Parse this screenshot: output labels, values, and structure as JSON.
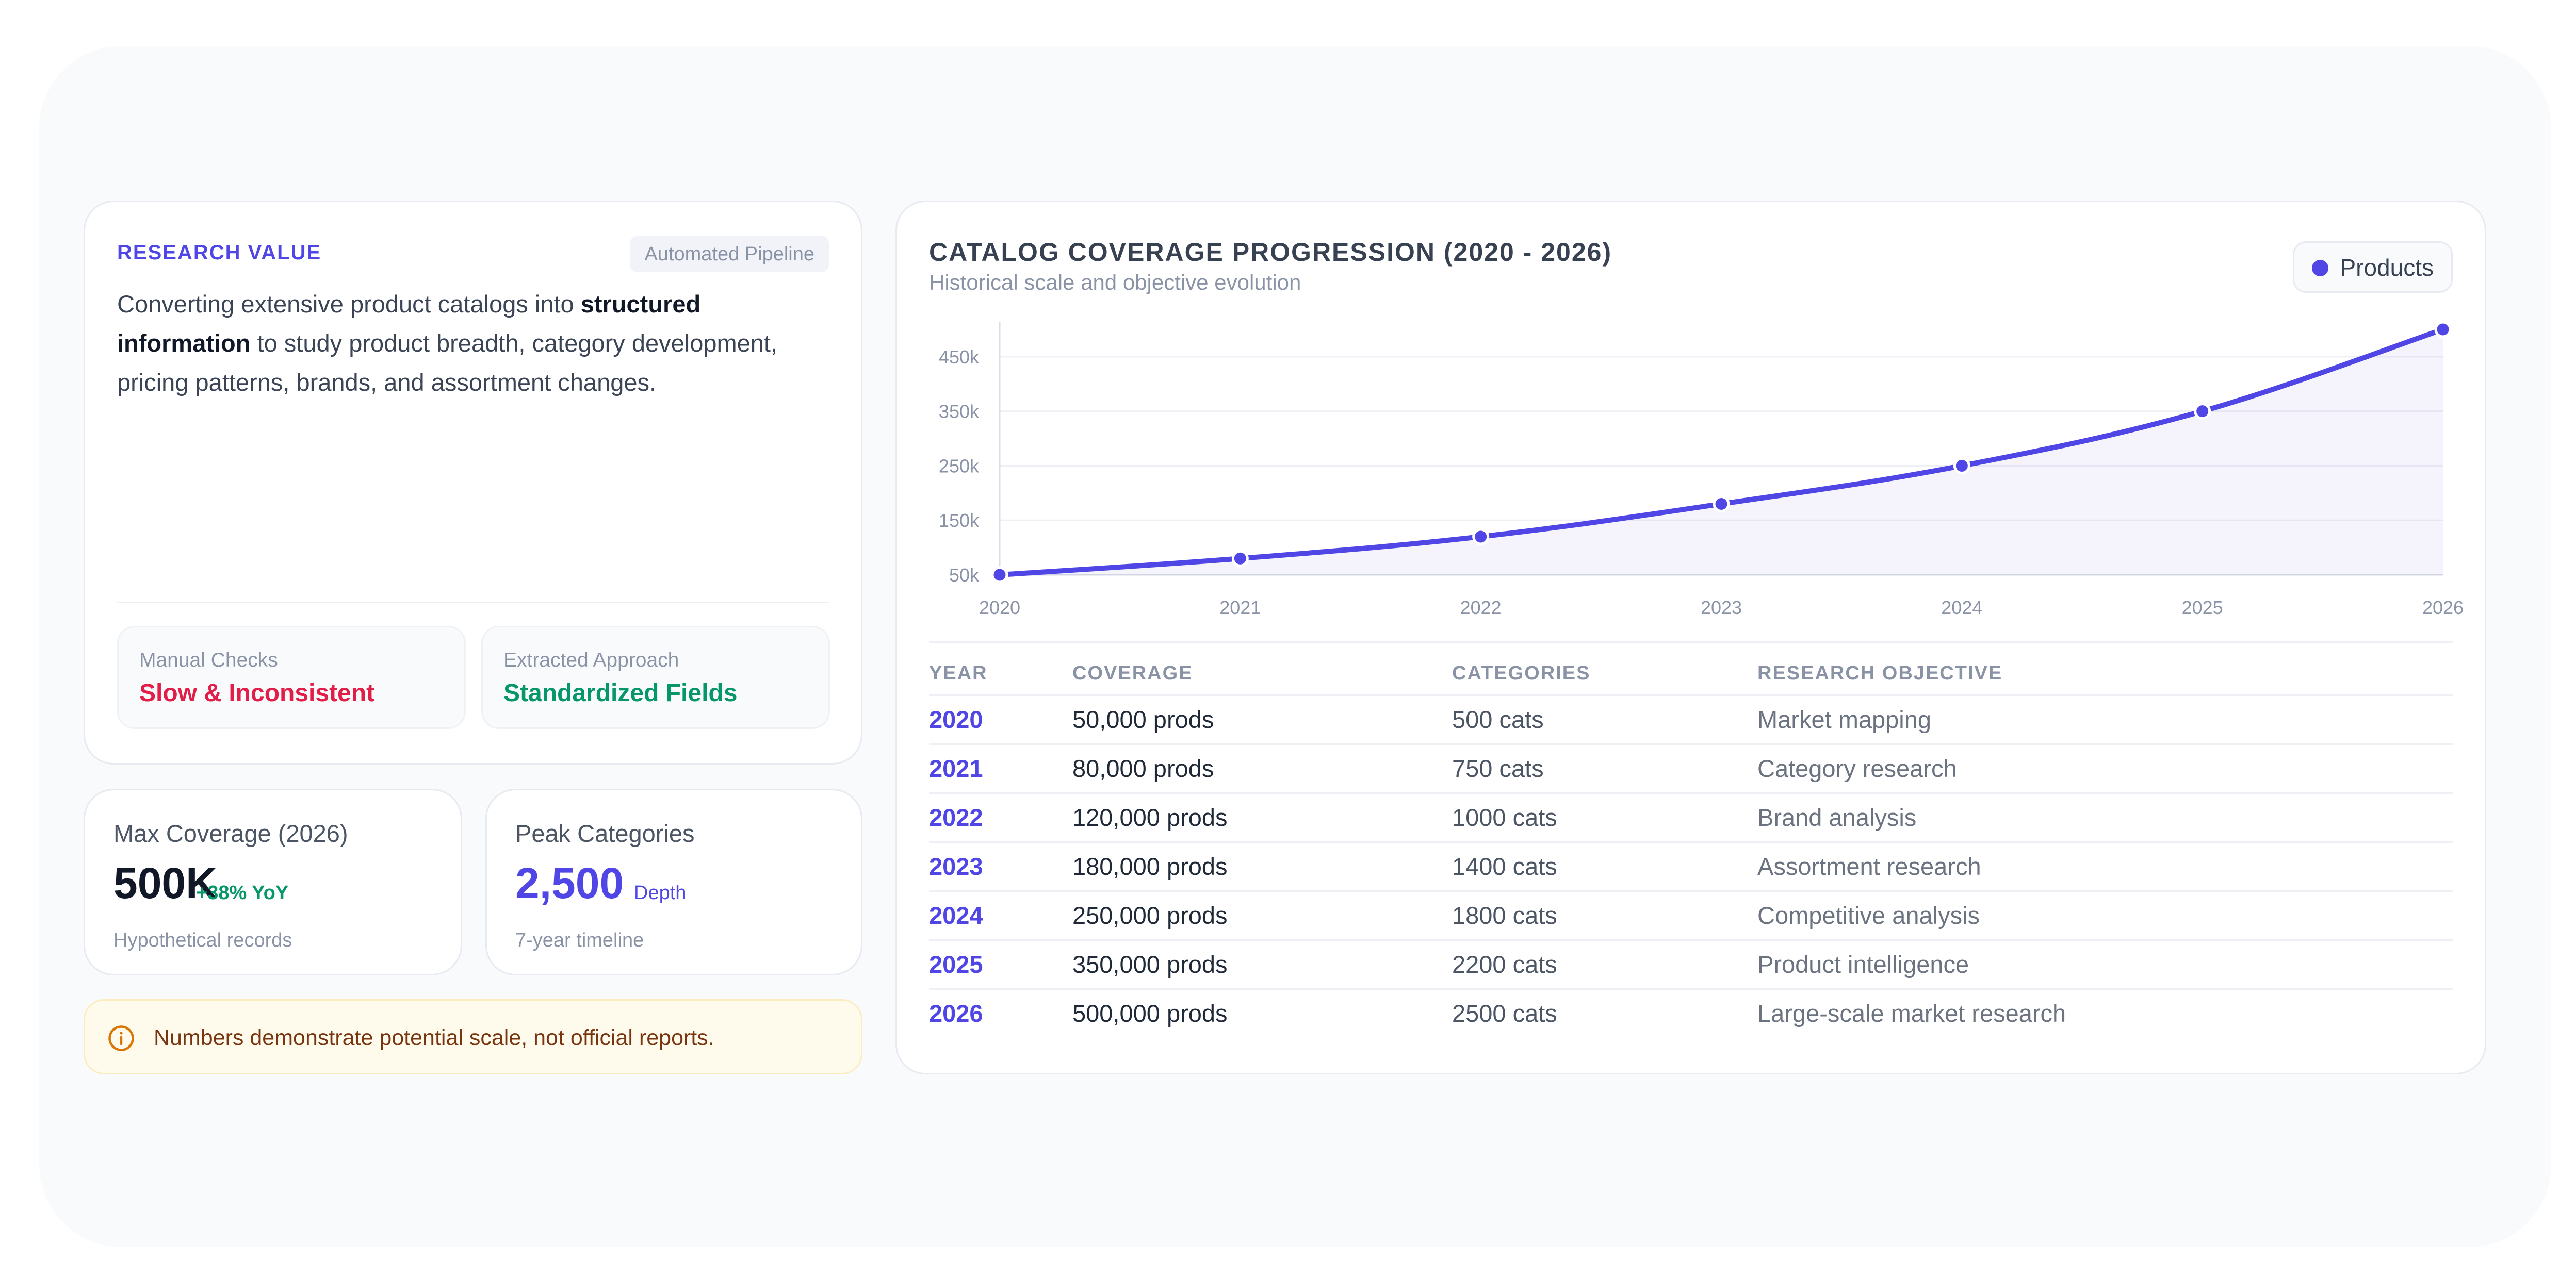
{
  "research": {
    "title": "RESEARCH VALUE",
    "badge": "Automated Pipeline",
    "text_1": "Converting extensive product catalogs into ",
    "text_bold": "structured information",
    "text_2": " to study product breadth, category development, pricing patterns, brands, and assortment changes.",
    "manual_label": "Manual Checks",
    "manual_value": "Slow & Inconsistent",
    "extracted_label": "Extracted Approach",
    "extracted_value": "Standardized Fields",
    "colors": {
      "accent": "#4f46e5",
      "negative": "#e11d48",
      "positive": "#059669"
    }
  },
  "stats": [
    {
      "label": "Max Coverage (2026)",
      "value": "500K",
      "delta": "+38% YoY",
      "note": "Hypothetical records"
    },
    {
      "label": "Peak Categories",
      "value": "2,500",
      "delta": "Depth",
      "note": "7-year timeline"
    }
  ],
  "warning": {
    "icon": "info-icon",
    "text": "Numbers demonstrate potential scale, not official reports."
  },
  "chart_card": {
    "title": "CATALOG COVERAGE PROGRESSION (2020 - 2026)",
    "subtitle": "Historical scale and objective evolution",
    "legend_label": "Products"
  },
  "chart_data": {
    "type": "area",
    "x": [
      2020,
      2021,
      2022,
      2023,
      2024,
      2025,
      2026
    ],
    "series": [
      {
        "name": "Products",
        "values": [
          50000,
          80000,
          120000,
          180000,
          250000,
          350000,
          500000
        ],
        "color": "#4f46e5"
      }
    ],
    "y_ticks": [
      50000,
      150000,
      250000,
      350000,
      450000
    ],
    "y_tick_labels": [
      "50k",
      "150k",
      "250k",
      "350k",
      "450k"
    ],
    "x_tick_labels": [
      "2020",
      "2021",
      "2022",
      "2023",
      "2024",
      "2025",
      "2026"
    ],
    "ylim": [
      50000,
      500000
    ],
    "grid": true,
    "legend": "top-right"
  },
  "table": {
    "headers": [
      "YEAR",
      "COVERAGE",
      "CATEGORIES",
      "RESEARCH OBJECTIVE"
    ],
    "rows": [
      [
        "2020",
        "50,000 prods",
        "500 cats",
        "Market mapping"
      ],
      [
        "2021",
        "80,000 prods",
        "750 cats",
        "Category research"
      ],
      [
        "2022",
        "120,000 prods",
        "1000 cats",
        "Brand analysis"
      ],
      [
        "2023",
        "180,000 prods",
        "1400 cats",
        "Assortment research"
      ],
      [
        "2024",
        "250,000 prods",
        "1800 cats",
        "Competitive analysis"
      ],
      [
        "2025",
        "350,000 prods",
        "2200 cats",
        "Product intelligence"
      ],
      [
        "2026",
        "500,000 prods",
        "2500 cats",
        "Large-scale market research"
      ]
    ]
  }
}
